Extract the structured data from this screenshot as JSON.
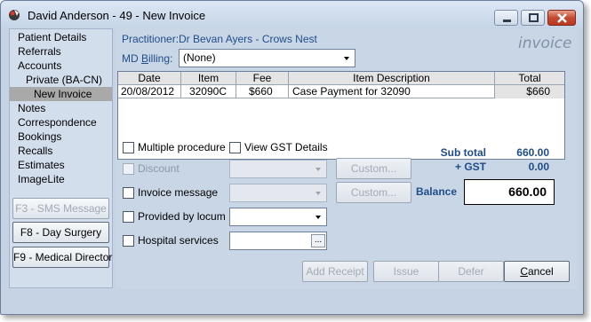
{
  "window": {
    "title": "David Anderson - 49 - New Invoice"
  },
  "sidebar": {
    "items": [
      {
        "label": "Patient Details"
      },
      {
        "label": "Referrals"
      },
      {
        "label": "Accounts"
      },
      {
        "label": "Private (BA-CN)"
      },
      {
        "label": "New Invoice"
      },
      {
        "label": "Notes"
      },
      {
        "label": "Correspondence"
      },
      {
        "label": "Bookings"
      },
      {
        "label": "Recalls"
      },
      {
        "label": "Estimates"
      },
      {
        "label": "ImageLite"
      }
    ],
    "buttons": {
      "sms": "F3 - SMS Message",
      "day_surgery": "F8 - Day Surgery",
      "medical_director": "F9 - Medical Director"
    }
  },
  "header": {
    "practitioner_label": "Practitioner:",
    "practitioner_value": "Dr Bevan Ayers - Crows Nest",
    "md_billing_label_pre": "MD ",
    "md_billing_label_u": "B",
    "md_billing_label_post": "illing:",
    "md_billing_value": "(None)",
    "watermark": "invoice"
  },
  "table": {
    "columns": [
      "Date",
      "Item",
      "Fee",
      "Item Description",
      "Total"
    ],
    "rows": [
      {
        "date": "20/08/2012",
        "item": "32090C",
        "fee": "$660",
        "description": "Case Payment for 32090",
        "total": "$660"
      }
    ]
  },
  "options": {
    "multiple_procedure": "Multiple procedure",
    "view_gst": "View GST Details",
    "discount": "Discount",
    "invoice_message": "Invoice message",
    "provided_by_locum": "Provided by locum",
    "hospital_services": "Hospital services",
    "custom_1": "Custom...",
    "custom_2": "Custom...",
    "ellipsis": "..."
  },
  "summary": {
    "subtotal_label": "Sub total",
    "subtotal_value": "660.00",
    "gst_label": "+ GST",
    "gst_value": "0.00",
    "balance_label": "Balance",
    "balance_value": "660.00"
  },
  "actions": {
    "add_receipt": "Add Receipt",
    "issue": "Issue",
    "defer": "Defer",
    "cancel_u": "C",
    "cancel_rest": "ancel"
  }
}
